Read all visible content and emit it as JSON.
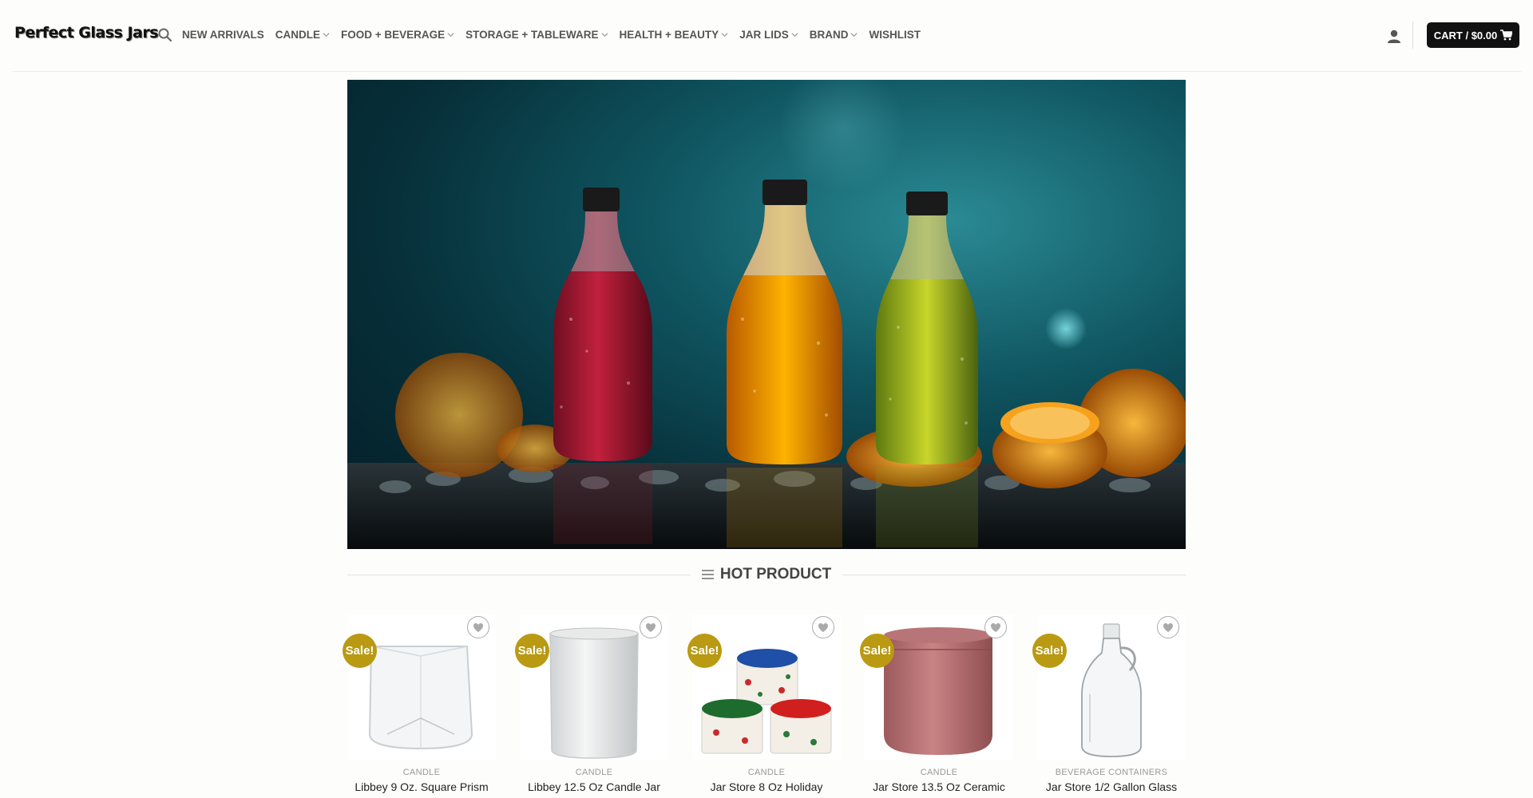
{
  "header": {
    "logo": "Perfect Glass Jars",
    "nav": [
      {
        "label": "NEW ARRIVALS",
        "dropdown": false
      },
      {
        "label": "CANDLE",
        "dropdown": true
      },
      {
        "label": "FOOD + BEVERAGE",
        "dropdown": true
      },
      {
        "label": "STORAGE + TABLEWARE",
        "dropdown": true
      },
      {
        "label": "HEALTH + BEAUTY",
        "dropdown": true
      },
      {
        "label": "JAR LIDS",
        "dropdown": true
      },
      {
        "label": "BRAND",
        "dropdown": true
      },
      {
        "label": "WISHLIST",
        "dropdown": false
      }
    ],
    "cart_label": "CART / $0.00"
  },
  "section": {
    "title": "HOT PRODUCT"
  },
  "products": [
    {
      "badge": "Sale!",
      "category": "CANDLE",
      "name": "Libbey 9 Oz. Square Prism"
    },
    {
      "badge": "Sale!",
      "category": "CANDLE",
      "name": "Libbey 12.5 Oz Candle Jar"
    },
    {
      "badge": "Sale!",
      "category": "CANDLE",
      "name": "Jar Store 8 Oz Holiday"
    },
    {
      "badge": "Sale!",
      "category": "CANDLE",
      "name": "Jar Store 13.5 Oz Ceramic"
    },
    {
      "badge": "Sale!",
      "category": "BEVERAGE CONTAINERS",
      "name": "Jar Store 1/2 Gallon Glass"
    }
  ],
  "colors": {
    "sale_badge": "#b99a12",
    "cart_bg": "#111111"
  }
}
